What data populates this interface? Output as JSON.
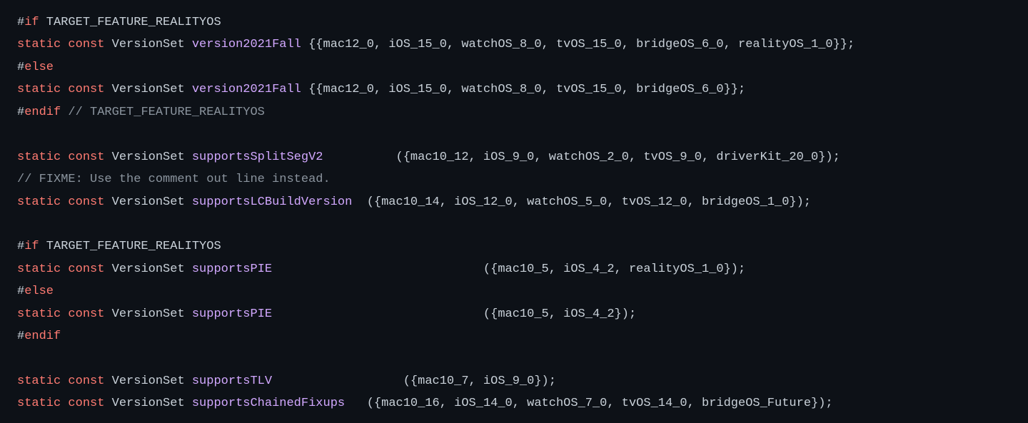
{
  "lines": [
    {
      "tokens": [
        {
          "cls": "tok-hash",
          "t": "#"
        },
        {
          "cls": "tok-pp",
          "t": "if"
        },
        {
          "cls": "tok-plain",
          "t": " TARGET_FEATURE_REALITYOS"
        }
      ]
    },
    {
      "tokens": [
        {
          "cls": "tok-kw",
          "t": "static"
        },
        {
          "cls": "tok-plain",
          "t": " "
        },
        {
          "cls": "tok-kw",
          "t": "const"
        },
        {
          "cls": "tok-plain",
          "t": " VersionSet "
        },
        {
          "cls": "tok-ident",
          "t": "version2021Fall"
        },
        {
          "cls": "tok-plain",
          "t": " {{mac12_0, iOS_15_0, watchOS_8_0, tvOS_15_0, bridgeOS_6_0, realityOS_1_0}};"
        }
      ]
    },
    {
      "tokens": [
        {
          "cls": "tok-hash",
          "t": "#"
        },
        {
          "cls": "tok-pp",
          "t": "else"
        }
      ]
    },
    {
      "tokens": [
        {
          "cls": "tok-kw",
          "t": "static"
        },
        {
          "cls": "tok-plain",
          "t": " "
        },
        {
          "cls": "tok-kw",
          "t": "const"
        },
        {
          "cls": "tok-plain",
          "t": " VersionSet "
        },
        {
          "cls": "tok-ident",
          "t": "version2021Fall"
        },
        {
          "cls": "tok-plain",
          "t": " {{mac12_0, iOS_15_0, watchOS_8_0, tvOS_15_0, bridgeOS_6_0}};"
        }
      ]
    },
    {
      "tokens": [
        {
          "cls": "tok-hash",
          "t": "#"
        },
        {
          "cls": "tok-pp",
          "t": "endif"
        },
        {
          "cls": "tok-plain",
          "t": " "
        },
        {
          "cls": "tok-comment",
          "t": "// TARGET_FEATURE_REALITYOS"
        }
      ]
    },
    {
      "tokens": [
        {
          "cls": "tok-plain",
          "t": " "
        }
      ]
    },
    {
      "tokens": [
        {
          "cls": "tok-kw",
          "t": "static"
        },
        {
          "cls": "tok-plain",
          "t": " "
        },
        {
          "cls": "tok-kw",
          "t": "const"
        },
        {
          "cls": "tok-plain",
          "t": " VersionSet "
        },
        {
          "cls": "tok-ident",
          "t": "supportsSplitSegV2"
        },
        {
          "cls": "tok-plain",
          "t": "          ({mac10_12, iOS_9_0, watchOS_2_0, tvOS_9_0, driverKit_20_0});"
        }
      ]
    },
    {
      "tokens": [
        {
          "cls": "tok-comment",
          "t": "// FIXME: Use the comment out line instead."
        }
      ]
    },
    {
      "tokens": [
        {
          "cls": "tok-kw",
          "t": "static"
        },
        {
          "cls": "tok-plain",
          "t": " "
        },
        {
          "cls": "tok-kw",
          "t": "const"
        },
        {
          "cls": "tok-plain",
          "t": " VersionSet "
        },
        {
          "cls": "tok-ident",
          "t": "supportsLCBuildVersion"
        },
        {
          "cls": "tok-plain",
          "t": "  ({mac10_14, iOS_12_0, watchOS_5_0, tvOS_12_0, bridgeOS_1_0});"
        }
      ]
    },
    {
      "tokens": [
        {
          "cls": "tok-plain",
          "t": " "
        }
      ]
    },
    {
      "tokens": [
        {
          "cls": "tok-hash",
          "t": "#"
        },
        {
          "cls": "tok-pp",
          "t": "if"
        },
        {
          "cls": "tok-plain",
          "t": " TARGET_FEATURE_REALITYOS"
        }
      ]
    },
    {
      "tokens": [
        {
          "cls": "tok-kw",
          "t": "static"
        },
        {
          "cls": "tok-plain",
          "t": " "
        },
        {
          "cls": "tok-kw",
          "t": "const"
        },
        {
          "cls": "tok-plain",
          "t": " VersionSet "
        },
        {
          "cls": "tok-ident",
          "t": "supportsPIE"
        },
        {
          "cls": "tok-plain",
          "t": "                             ({mac10_5, iOS_4_2, realityOS_1_0});"
        }
      ]
    },
    {
      "tokens": [
        {
          "cls": "tok-hash",
          "t": "#"
        },
        {
          "cls": "tok-pp",
          "t": "else"
        }
      ]
    },
    {
      "tokens": [
        {
          "cls": "tok-kw",
          "t": "static"
        },
        {
          "cls": "tok-plain",
          "t": " "
        },
        {
          "cls": "tok-kw",
          "t": "const"
        },
        {
          "cls": "tok-plain",
          "t": " VersionSet "
        },
        {
          "cls": "tok-ident",
          "t": "supportsPIE"
        },
        {
          "cls": "tok-plain",
          "t": "                             ({mac10_5, iOS_4_2});"
        }
      ]
    },
    {
      "tokens": [
        {
          "cls": "tok-hash",
          "t": "#"
        },
        {
          "cls": "tok-pp",
          "t": "endif"
        }
      ]
    },
    {
      "tokens": [
        {
          "cls": "tok-plain",
          "t": " "
        }
      ]
    },
    {
      "tokens": [
        {
          "cls": "tok-kw",
          "t": "static"
        },
        {
          "cls": "tok-plain",
          "t": " "
        },
        {
          "cls": "tok-kw",
          "t": "const"
        },
        {
          "cls": "tok-plain",
          "t": " VersionSet "
        },
        {
          "cls": "tok-ident",
          "t": "supportsTLV"
        },
        {
          "cls": "tok-plain",
          "t": "                  ({mac10_7, iOS_9_0});"
        }
      ]
    },
    {
      "tokens": [
        {
          "cls": "tok-kw",
          "t": "static"
        },
        {
          "cls": "tok-plain",
          "t": " "
        },
        {
          "cls": "tok-kw",
          "t": "const"
        },
        {
          "cls": "tok-plain",
          "t": " VersionSet "
        },
        {
          "cls": "tok-ident",
          "t": "supportsChainedFixups"
        },
        {
          "cls": "tok-plain",
          "t": "   ({mac10_16, iOS_14_0, watchOS_7_0, tvOS_14_0, bridgeOS_Future});"
        }
      ]
    }
  ]
}
